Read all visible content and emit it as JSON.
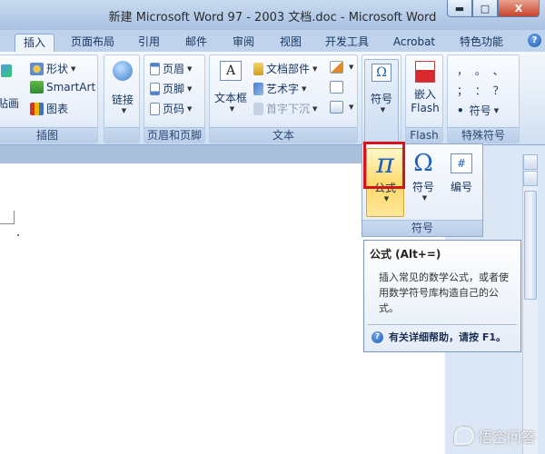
{
  "window": {
    "title": "新建 Microsoft Word 97 - 2003 文档.doc - Microsoft Word",
    "minimize_label": "▬",
    "maximize_label": "□",
    "close_label": "X"
  },
  "tabs": [
    {
      "label": "插入",
      "active": true
    },
    {
      "label": "页面布局"
    },
    {
      "label": "引用"
    },
    {
      "label": "邮件"
    },
    {
      "label": "审阅"
    },
    {
      "label": "视图"
    },
    {
      "label": "开发工具"
    },
    {
      "label": "Acrobat"
    },
    {
      "label": "特色功能"
    }
  ],
  "help_icon": "?",
  "ribbon": {
    "illustrations": {
      "label": "插图",
      "partial_left": "贴画",
      "shapes": "形状",
      "smartart": "SmartArt",
      "chart": "图表"
    },
    "links": {
      "label": "链接",
      "link": "链接"
    },
    "header_footer": {
      "label": "页眉和页脚",
      "header": "页眉",
      "footer": "页脚",
      "page_number": "页码"
    },
    "text": {
      "label": "文本",
      "textbox": "文本框",
      "quickparts": "文档部件",
      "wordart": "艺术字",
      "dropcap": "首字下沉"
    },
    "symbols": {
      "label": "",
      "symbol": "符号"
    },
    "flash": {
      "label": "Flash",
      "embed_line1": "嵌入",
      "embed_line2": "Flash"
    },
    "special": {
      "label": "特殊符号",
      "symbol": "符号",
      "row1": "，  。  、",
      "row2": "；  ：  ？"
    }
  },
  "dropdown": {
    "label": "符号",
    "formula": "公式",
    "symbol": "符号",
    "numbering": "编号",
    "pi_glyph": "π",
    "omega_glyph": "Ω",
    "hash_glyph": "#"
  },
  "tooltip": {
    "title": "公式 (Alt+=)",
    "body": "插入常见的数学公式，或者使用数学符号库构造自己的公式。",
    "help": "有关详细帮助，请按 F1。"
  },
  "watermark": "悟空问答",
  "colors": {
    "highlight": "#d4141c",
    "active_button": "#ffd96b"
  }
}
